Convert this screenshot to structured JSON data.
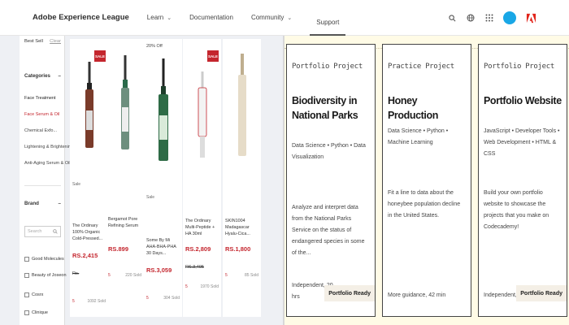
{
  "nav": {
    "brand": "Adobe Experience League",
    "items": [
      {
        "label": "Learn",
        "dropdown": true
      },
      {
        "label": "Documentation",
        "dropdown": false
      },
      {
        "label": "Community",
        "dropdown": true
      },
      {
        "label": "Support",
        "dropdown": false,
        "active": true
      }
    ],
    "icons": [
      "search-icon",
      "globe-icon",
      "apps-grid-icon",
      "avatar",
      "adobe-logo-icon"
    ]
  },
  "filters": {
    "sort_label": "Best Sell",
    "sort_link": "Clear",
    "category_title": "Categories",
    "categories": [
      "Face Treatment",
      "Face Serum & Oil",
      "Chemical Exfo...",
      "Lightening & Brightening",
      "Anti-Aging Serum & Oil"
    ],
    "brand_title": "Brand",
    "search_placeholder": "Search",
    "brands": [
      "Good Molecules",
      "Beauty of Joseon",
      "Cosrx",
      "Clinique"
    ]
  },
  "products": [
    {
      "badge": "SALE",
      "tag": "Sale",
      "name": "The Ordinary 100% Organic Cold-Pressed...",
      "price": "RS.2,415",
      "orig": "Rs.",
      "rating": "5",
      "reviews": "1092 Sold"
    },
    {
      "badge": "",
      "tag": "",
      "name": "Bergamot Pore Refining Serum",
      "price": "RS.899",
      "orig": "",
      "rating": "5",
      "reviews": "220 Sold"
    },
    {
      "badge": "",
      "top": "20% Off",
      "tag": "Sale",
      "name": "Some By Mi AHA-BHA-PHA 30 Days...",
      "price": "RS.3,059",
      "orig": "",
      "rating": "5",
      "reviews": "304 Sold"
    },
    {
      "badge": "SALE",
      "tag": "",
      "name": "The Ordinary Multi-Peptide + HA 30ml",
      "price": "RS.2,809",
      "orig": "RS.3,495",
      "rating": "5",
      "reviews": "1970 Sold"
    },
    {
      "badge": "",
      "tag": "",
      "name": "SKIN1004 Madagascar Hyalu-Cica...",
      "price": "RS.1,800",
      "orig": "",
      "rating": "5",
      "reviews": "85 Sold"
    }
  ],
  "projects": [
    {
      "type": "Portfolio Project",
      "title": "Biodiversity in National Parks",
      "topics": "Data Science • Python • Data Visualization",
      "desc": "Analyze and interpret data from the National Parks Service on the status of endangered species in some of the...",
      "time": "Independent, 20 hrs",
      "badge": "Portfolio Ready"
    },
    {
      "type": "Practice Project",
      "title": "Honey Production",
      "topics": "Data Science • Python • Machine Learning",
      "desc": "Fit a line to data about the honeybee population decline in the United States.",
      "time": "More guidance, 42 min",
      "badge": ""
    },
    {
      "type": "Portfolio Project",
      "title": "Portfolio Website",
      "topics": "JavaScript • Developer Tools • Web Development • HTML & CSS",
      "desc": "Build your own portfolio website to showcase the projects that you make on Codecademy!",
      "time": "Independent, 6 hrs",
      "badge": "Portfolio Ready"
    }
  ],
  "colors": {
    "accent_red": "#c4262e",
    "avatar_blue": "#19a7e6",
    "panel_bg": "#fffbe6"
  }
}
